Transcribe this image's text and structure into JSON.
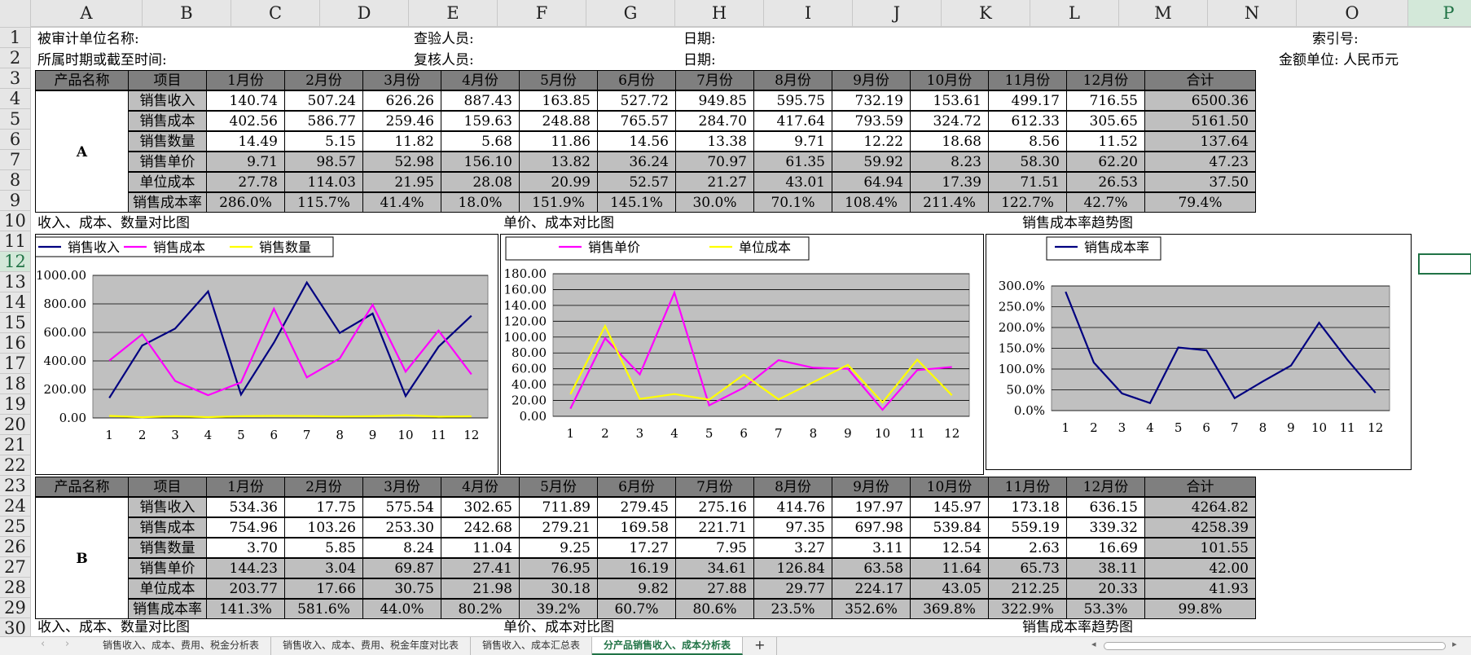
{
  "columns": [
    "A",
    "B",
    "C",
    "D",
    "E",
    "F",
    "G",
    "H",
    "I",
    "J",
    "K",
    "L",
    "M",
    "N",
    "O",
    "P"
  ],
  "rows": [
    "1",
    "2",
    "3",
    "4",
    "5",
    "6",
    "7",
    "8",
    "9",
    "10",
    "11",
    "12",
    "13",
    "14",
    "15",
    "16",
    "17",
    "18",
    "19",
    "20",
    "21",
    "22",
    "23",
    "24",
    "25",
    "26",
    "27",
    "28",
    "29",
    "30"
  ],
  "header": {
    "unit_name_label": "被审计单位名称:",
    "inspector_label": "查验人员:",
    "date_label": "日期:",
    "index_label": "索引号:",
    "period_label": "所属时期或截至时间:",
    "reviewer_label": "复核人员:",
    "currency_label": "金额单位: 人民币元"
  },
  "table_headers": [
    "产品名称",
    "项目",
    "1月份",
    "2月份",
    "3月份",
    "4月份",
    "5月份",
    "6月份",
    "7月份",
    "8月份",
    "9月份",
    "10月份",
    "11月份",
    "12月份",
    "合计"
  ],
  "row_labels": [
    "销售收入",
    "销售成本",
    "销售数量",
    "销售单价",
    "单位成本",
    "销售成本率"
  ],
  "product_a": {
    "name": "A",
    "rows": [
      [
        "140.74",
        "507.24",
        "626.26",
        "887.43",
        "163.85",
        "527.72",
        "949.85",
        "595.75",
        "732.19",
        "153.61",
        "499.17",
        "716.55",
        "6500.36"
      ],
      [
        "402.56",
        "586.77",
        "259.46",
        "159.63",
        "248.88",
        "765.57",
        "284.70",
        "417.64",
        "793.59",
        "324.72",
        "612.33",
        "305.65",
        "5161.50"
      ],
      [
        "14.49",
        "5.15",
        "11.82",
        "5.68",
        "11.86",
        "14.56",
        "13.38",
        "9.71",
        "12.22",
        "18.68",
        "8.56",
        "11.52",
        "137.64"
      ],
      [
        "9.71",
        "98.57",
        "52.98",
        "156.10",
        "13.82",
        "36.24",
        "70.97",
        "61.35",
        "59.92",
        "8.23",
        "58.30",
        "62.20",
        "47.23"
      ],
      [
        "27.78",
        "114.03",
        "21.95",
        "28.08",
        "20.99",
        "52.57",
        "21.27",
        "43.01",
        "64.94",
        "17.39",
        "71.51",
        "26.53",
        "37.50"
      ],
      [
        "286.0%",
        "115.7%",
        "41.4%",
        "18.0%",
        "151.9%",
        "145.1%",
        "30.0%",
        "70.1%",
        "108.4%",
        "211.4%",
        "122.7%",
        "42.7%",
        "79.4%"
      ]
    ]
  },
  "product_b": {
    "name": "B",
    "rows": [
      [
        "534.36",
        "17.75",
        "575.54",
        "302.65",
        "711.89",
        "279.45",
        "275.16",
        "414.76",
        "197.97",
        "145.97",
        "173.18",
        "636.15",
        "4264.82"
      ],
      [
        "754.96",
        "103.26",
        "253.30",
        "242.68",
        "279.21",
        "169.58",
        "221.71",
        "97.35",
        "697.98",
        "539.84",
        "559.19",
        "339.32",
        "4258.39"
      ],
      [
        "3.70",
        "5.85",
        "8.24",
        "11.04",
        "9.25",
        "17.27",
        "7.95",
        "3.27",
        "3.11",
        "12.54",
        "2.63",
        "16.69",
        "101.55"
      ],
      [
        "144.23",
        "3.04",
        "69.87",
        "27.41",
        "76.95",
        "16.19",
        "34.61",
        "126.84",
        "63.58",
        "11.64",
        "65.73",
        "38.11",
        "42.00"
      ],
      [
        "203.77",
        "17.66",
        "30.75",
        "21.98",
        "30.18",
        "9.82",
        "27.88",
        "29.77",
        "224.17",
        "43.05",
        "212.25",
        "20.33",
        "41.93"
      ],
      [
        "141.3%",
        "581.6%",
        "44.0%",
        "80.2%",
        "39.2%",
        "60.7%",
        "80.6%",
        "23.5%",
        "352.6%",
        "369.8%",
        "322.9%",
        "53.3%",
        "99.8%"
      ]
    ]
  },
  "chart_titles": {
    "chart1": "收入、成本、数量对比图",
    "chart2": "单价、成本对比图",
    "chart3": "销售成本率趋势图"
  },
  "sheet_tabs": [
    "销售收入、成本、费用、税金分析表",
    "销售收入、成本、费用、税金年度对比表",
    "销售收入、成本汇总表",
    "分产品销售收入、成本分析表"
  ],
  "add_sheet": "+",
  "colors": {
    "navy": "#000080",
    "magenta": "#ff00ff",
    "yellow": "#ffff00",
    "plot_bg": "#c0c0c0",
    "active_tab": "#217346"
  },
  "chart_data": [
    {
      "type": "line",
      "x": [
        1,
        2,
        3,
        4,
        5,
        6,
        7,
        8,
        9,
        10,
        11,
        12
      ],
      "ylim": [
        0,
        1000
      ],
      "yticks": [
        "0.00",
        "200.00",
        "400.00",
        "600.00",
        "800.00",
        "1000.00"
      ],
      "series": [
        {
          "name": "销售收入",
          "color": "#000080",
          "values": [
            140.74,
            507.24,
            626.26,
            887.43,
            163.85,
            527.72,
            949.85,
            595.75,
            732.19,
            153.61,
            499.17,
            716.55
          ]
        },
        {
          "name": "销售成本",
          "color": "#ff00ff",
          "values": [
            402.56,
            586.77,
            259.46,
            159.63,
            248.88,
            765.57,
            284.7,
            417.64,
            793.59,
            324.72,
            612.33,
            305.65
          ]
        },
        {
          "name": "销售数量",
          "color": "#ffff00",
          "values": [
            14.49,
            5.15,
            11.82,
            5.68,
            11.86,
            14.56,
            13.38,
            9.71,
            12.22,
            18.68,
            8.56,
            11.52
          ]
        }
      ]
    },
    {
      "type": "line",
      "x": [
        1,
        2,
        3,
        4,
        5,
        6,
        7,
        8,
        9,
        10,
        11,
        12
      ],
      "ylim": [
        0,
        180
      ],
      "yticks": [
        "0.00",
        "20.00",
        "40.00",
        "60.00",
        "80.00",
        "100.00",
        "120.00",
        "140.00",
        "160.00",
        "180.00"
      ],
      "series": [
        {
          "name": "销售单价",
          "color": "#ff00ff",
          "values": [
            9.71,
            98.57,
            52.98,
            156.1,
            13.82,
            36.24,
            70.97,
            61.35,
            59.92,
            8.23,
            58.3,
            62.2
          ]
        },
        {
          "name": "单位成本",
          "color": "#ffff00",
          "values": [
            27.78,
            114.03,
            21.95,
            28.08,
            20.99,
            52.57,
            21.27,
            43.01,
            64.94,
            17.39,
            71.51,
            26.53
          ]
        }
      ]
    },
    {
      "type": "line",
      "x": [
        1,
        2,
        3,
        4,
        5,
        6,
        7,
        8,
        9,
        10,
        11,
        12
      ],
      "ylim": [
        0,
        3
      ],
      "yticks": [
        "0.0%",
        "50.0%",
        "100.0%",
        "150.0%",
        "200.0%",
        "250.0%",
        "300.0%"
      ],
      "series": [
        {
          "name": "销售成本率",
          "color": "#000080",
          "values": [
            2.86,
            1.157,
            0.414,
            0.18,
            1.519,
            1.451,
            0.3,
            0.701,
            1.084,
            2.114,
            1.227,
            0.427
          ]
        }
      ]
    }
  ]
}
